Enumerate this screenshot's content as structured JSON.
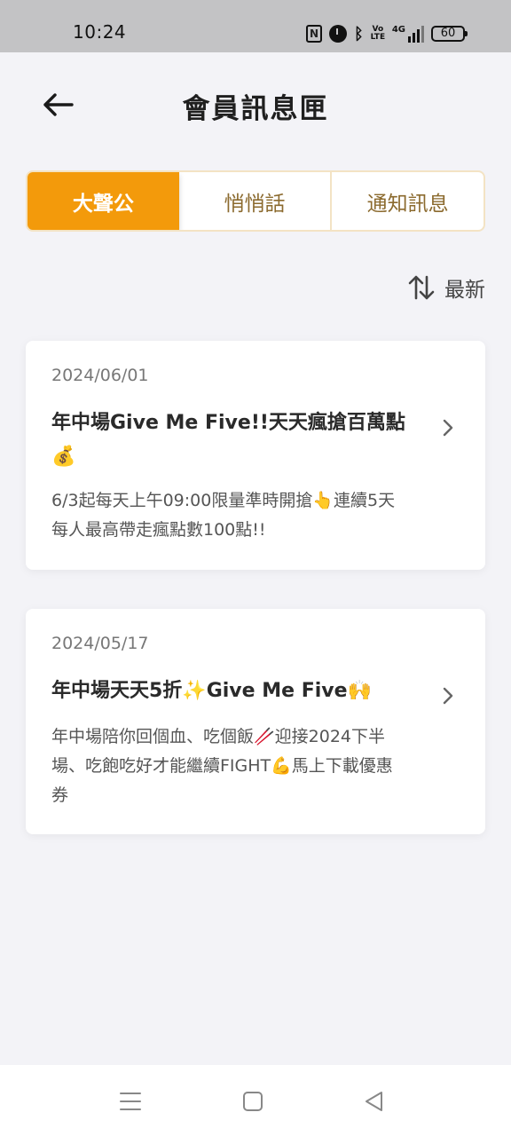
{
  "status_bar": {
    "time": "10:24",
    "volte_label": "Vo\nLTE",
    "signal_label": "4G",
    "battery": "60",
    "icons": [
      "nfc-icon",
      "alarm-icon",
      "bluetooth-icon",
      "volte-icon",
      "signal-icon",
      "battery-icon"
    ]
  },
  "header": {
    "back_icon": "arrow-left-icon",
    "title": "會員訊息匣"
  },
  "tabs": [
    {
      "label": "大聲公",
      "active": true
    },
    {
      "label": "悄悄話",
      "active": false
    },
    {
      "label": "通知訊息",
      "active": false
    }
  ],
  "sort": {
    "icon": "sort-arrows-icon",
    "label": "最新"
  },
  "messages": [
    {
      "date": "2024/06/01",
      "title": "年中場Give Me Five!!天天瘋搶百萬點💰",
      "body": "6/3起每天上午09:00限量準時開搶👆連續5天每人最高帶走瘋點數100點!!"
    },
    {
      "date": "2024/05/17",
      "title": "年中場天天5折✨Give Me Five🙌",
      "body": "年中場陪你回個血、吃個飯🥢迎接2024下半場、吃飽吃好才能繼續FIGHT💪馬上下載優惠券"
    }
  ],
  "nav_bar": {
    "icons": [
      "menu-icon",
      "home-square-icon",
      "back-triangle-icon"
    ]
  },
  "colors": {
    "accent": "#f39a0b",
    "tab_text": "#8b6a2e",
    "tab_border": "#f3e3c4",
    "background": "#f3f3f7",
    "status_bar": "#c3c3c5"
  }
}
